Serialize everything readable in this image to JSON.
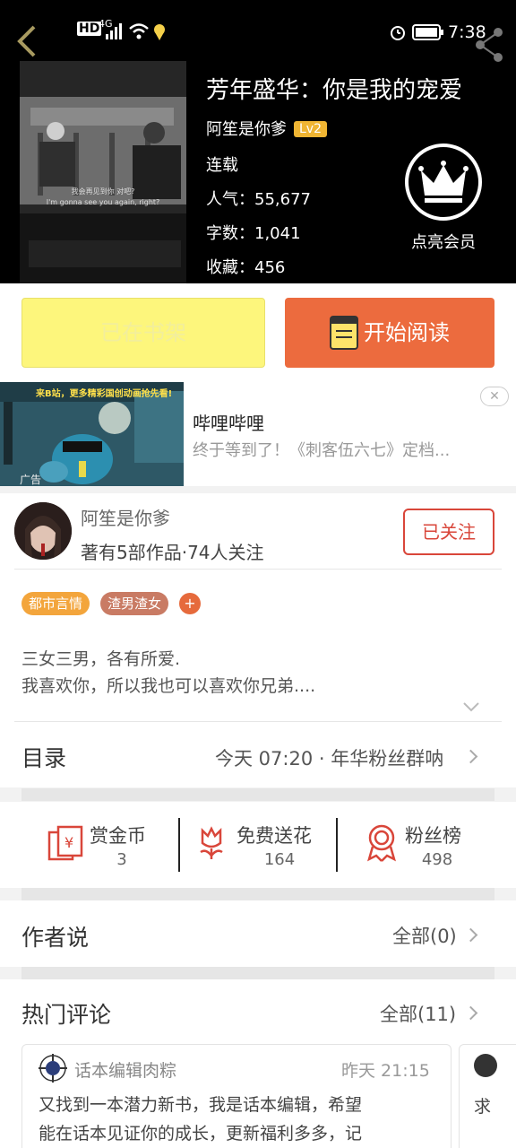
{
  "status_bar": {
    "left_indicators": "HD 4G",
    "time": "7:38"
  },
  "book": {
    "title": "芳年盛华：你是我的宠爱",
    "author": "阿笙是你爹",
    "level": "Lv2",
    "status": "连载",
    "popularity": "人气：55,677",
    "word_count": "字数：1,041",
    "favorites": "收藏：456",
    "cover_subtitle_cn": "我会再见到你 对吧?",
    "cover_subtitle_en": "I'm gonna see you again, right?"
  },
  "vip": {
    "label": "点亮会员"
  },
  "actions": {
    "shelf_label": "已在书架",
    "read_label": "开始阅读"
  },
  "ad": {
    "banner_text": "来B站，更多精彩国创动画抢先看!",
    "tag": "广告",
    "title": "哔哩哔哩",
    "description": "终于等到了！《刺客伍六七》定档..."
  },
  "author_card": {
    "name": "阿笙是你爹",
    "stats": "著有5部作品·74人关注",
    "follow_label": "已关注"
  },
  "tags": [
    "都市言情",
    "渣男渣女"
  ],
  "tag_add": "+",
  "intro": {
    "line1": "三女三男，各有所爱.",
    "line2": "我喜欢你，所以我也可以喜欢你兄弟...."
  },
  "toc": {
    "label": "目录",
    "latest": "今天 07:20 · 年华粉丝群呐"
  },
  "stats": [
    {
      "label": "赏金币",
      "value": "3"
    },
    {
      "label": "免费送花",
      "value": "164"
    },
    {
      "label": "粉丝榜",
      "value": "498"
    }
  ],
  "author_says": {
    "label": "作者说",
    "count": "全部(0)"
  },
  "hot_comments": {
    "label": "热门评论",
    "count": "全部(11)"
  },
  "comment": {
    "user": "话本编辑肉粽",
    "time": "昨天 21:15",
    "line1": "又找到一本潜力新书，我是话本编辑，希望",
    "line2": "能在话本见证你的成长，更新福利多多，记"
  },
  "comment_peek": "求",
  "colors": {
    "accent_orange": "#ec6b3e",
    "shelf_yellow": "#fdf67c",
    "follow_red": "#d9463a",
    "tag_orange": "#f3a53c",
    "tag_brown": "#c97b64"
  }
}
